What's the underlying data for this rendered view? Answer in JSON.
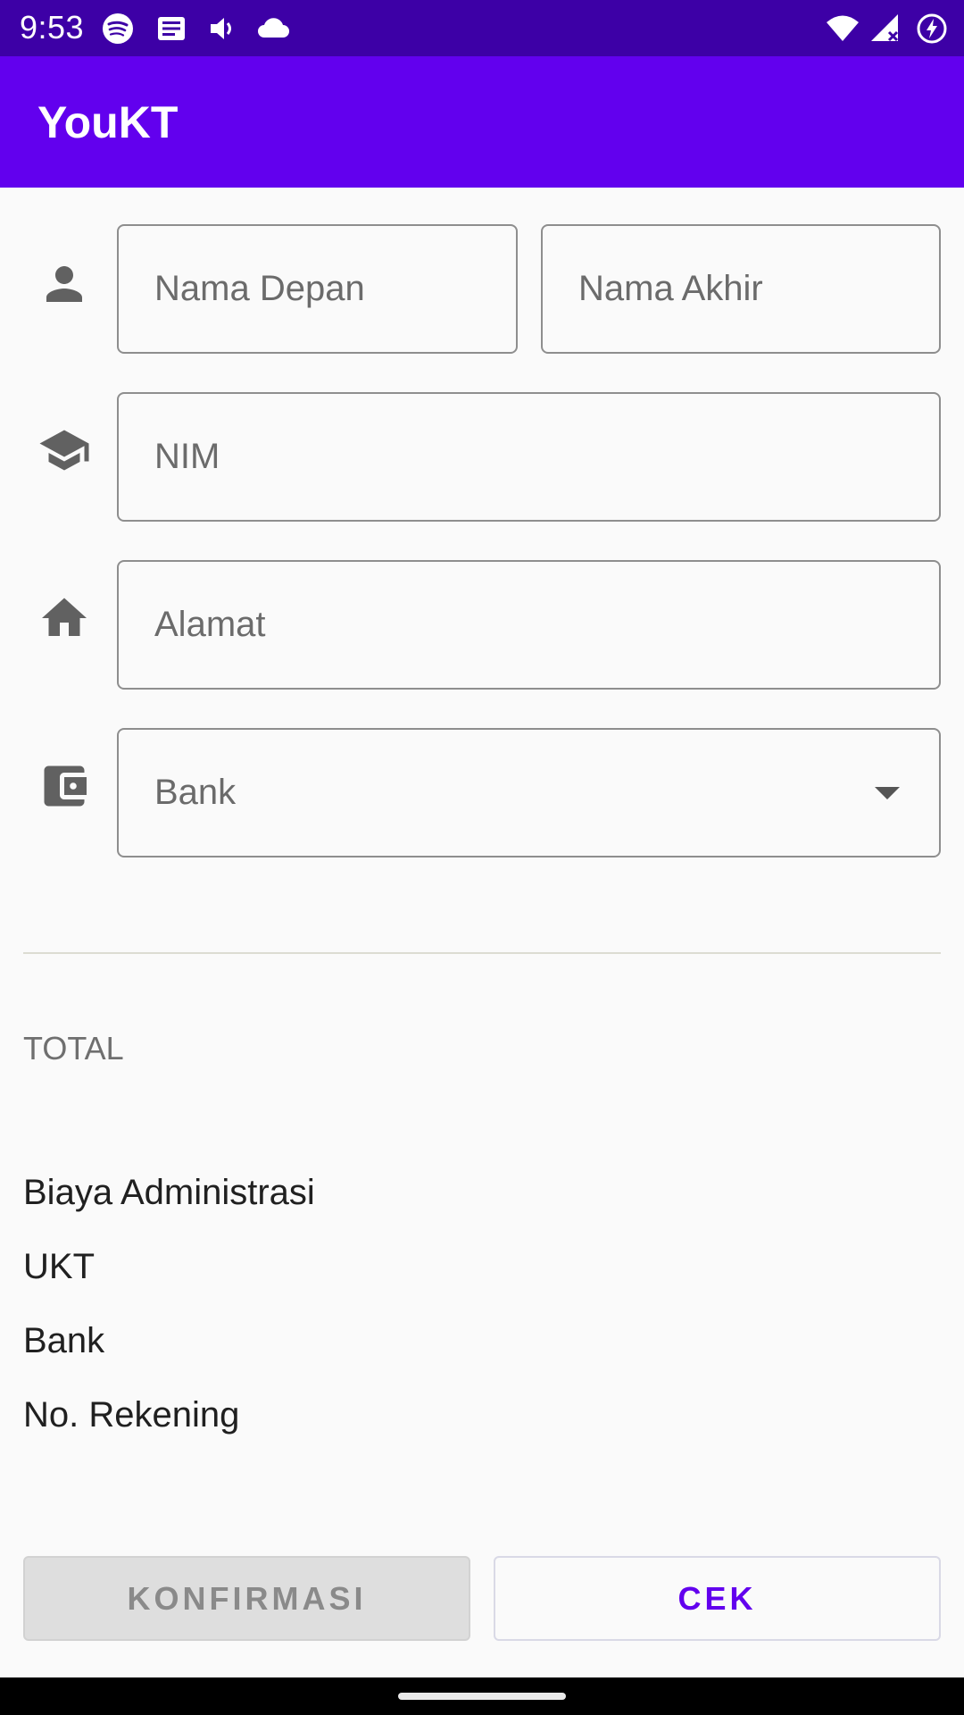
{
  "status_bar": {
    "time": "9:53",
    "left_icons": [
      "spotify-icon",
      "news-icon",
      "volume-icon",
      "cloud-icon"
    ],
    "right_icons": [
      "wifi-icon",
      "signal-icon",
      "battery-charging-icon"
    ]
  },
  "app_bar": {
    "title": "YouKT",
    "color": "#6200ee",
    "status_color": "#3d00a6"
  },
  "form": {
    "first_name": {
      "placeholder": "Nama Depan",
      "icon": "person-icon"
    },
    "last_name": {
      "placeholder": "Nama Akhir"
    },
    "nim": {
      "placeholder": "NIM",
      "icon": "graduation-cap-icon"
    },
    "address": {
      "placeholder": "Alamat",
      "icon": "home-icon"
    },
    "bank": {
      "selected": "Bank",
      "icon": "wallet-icon"
    }
  },
  "summary": {
    "total_label": "TOTAL",
    "items": [
      "Biaya Administrasi",
      "UKT",
      "Bank",
      "No. Rekening"
    ]
  },
  "buttons": {
    "confirm_label": "KONFIRMASI",
    "check_label": "CEK",
    "accent": "#6200ee"
  }
}
